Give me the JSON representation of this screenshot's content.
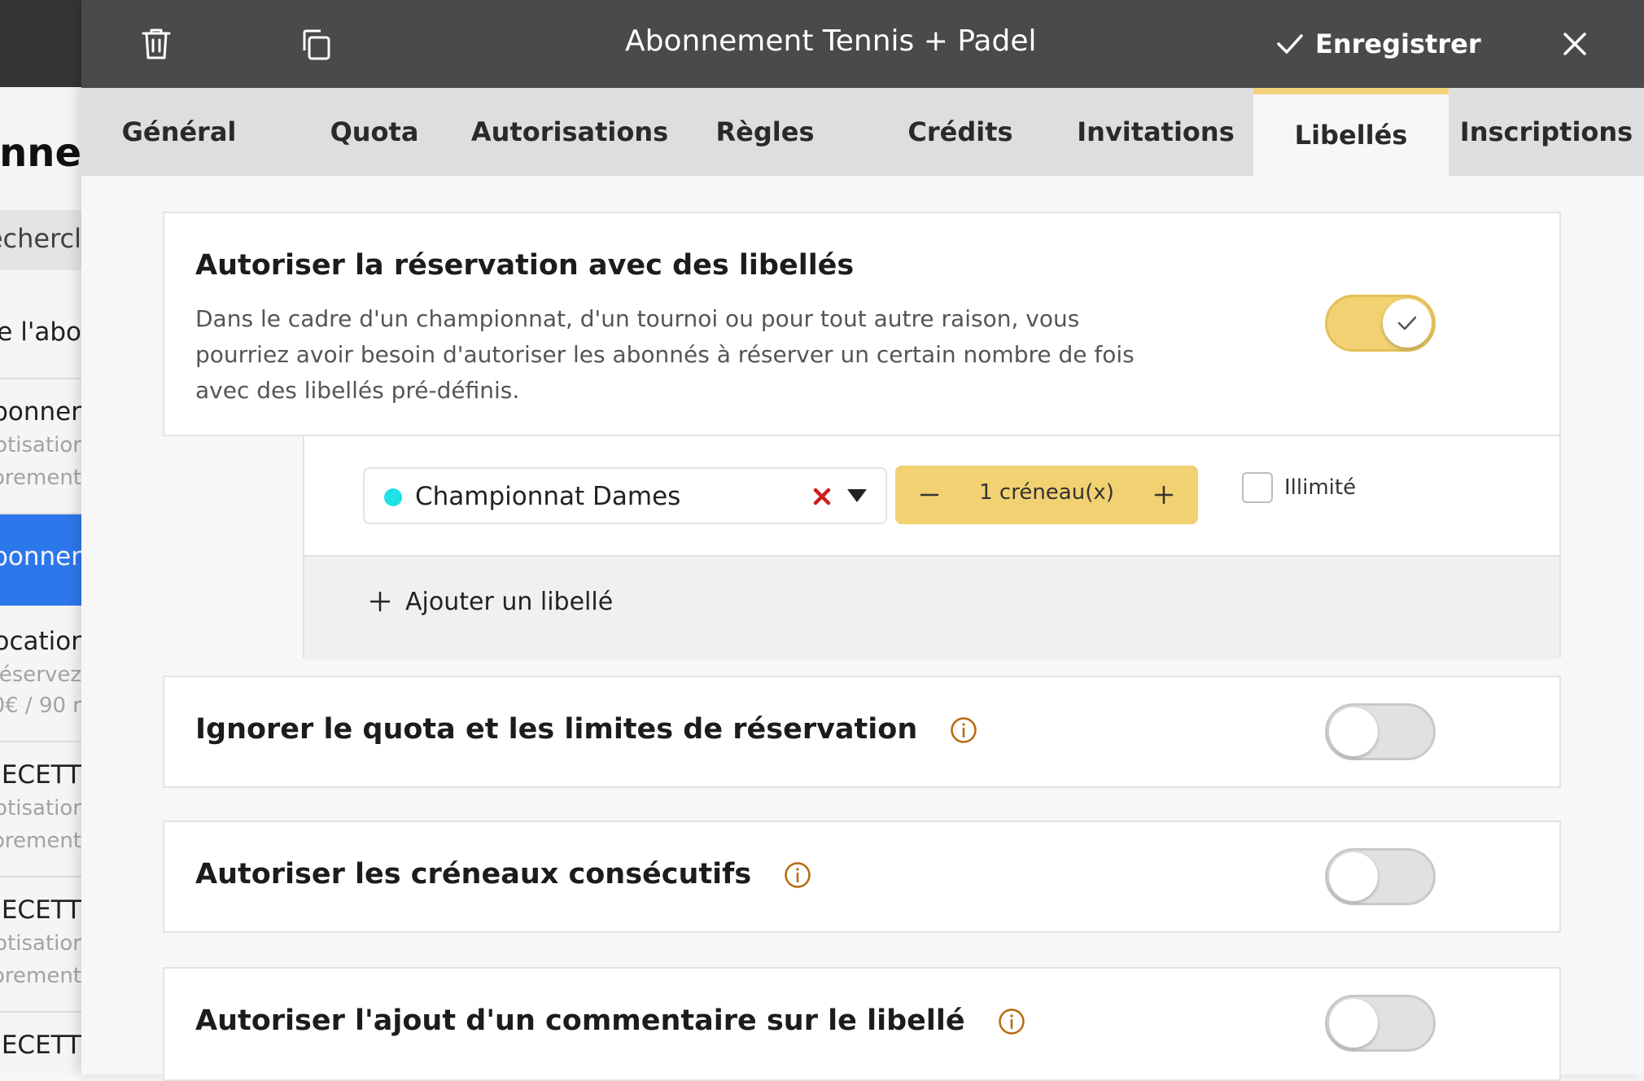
{
  "background": {
    "title": "onne",
    "search_placeholder": "echercl",
    "rows": [
      {
        "l1": "de l'abo",
        "l2": ""
      },
      {
        "l1": "bonner",
        "l2": "otisatior",
        "l3": "orement"
      },
      {
        "l1": "bonner",
        "l2": "",
        "l3": ""
      },
      {
        "l1": "ocatior",
        "l2": "éservez",
        "l3": "0€ / 90 r"
      },
      {
        "l1": "ECETT",
        "l2": "otisatior",
        "l3": "orement"
      },
      {
        "l1": "ECETT",
        "l2": "otisatior",
        "l3": "orement"
      },
      {
        "l1": "ECETT",
        "l2": "",
        "l3": ""
      }
    ]
  },
  "header": {
    "title": "Abonnement Tennis + Padel",
    "save_label": "Enregistrer",
    "icons": [
      "trash-icon",
      "duplicate-icon",
      "check-icon",
      "close-icon"
    ]
  },
  "tabs": [
    {
      "label": "Général"
    },
    {
      "label": "Quota"
    },
    {
      "label": "Autorisations"
    },
    {
      "label": "Règles"
    },
    {
      "label": "Crédits"
    },
    {
      "label": "Invitations"
    },
    {
      "label": "Libellés",
      "active": true
    },
    {
      "label": "Inscriptions"
    }
  ],
  "labels_section": {
    "title": "Autoriser la réservation avec des libellés",
    "description": "Dans le cadre d'un championnat, d'un tournoi ou pour tout autre raison, vous pourriez avoir besoin d'autoriser les abonnés à réserver un certain nombre de fois avec des libellés pré-définis.",
    "enabled": true,
    "entry": {
      "label": "Championnat Dames",
      "label_color": "#1fe1e6",
      "quantity_text": "1 créneau(x)",
      "quantity": 1,
      "unlimited_label": "Illimité",
      "unlimited": false
    },
    "add_label": "Ajouter un libellé"
  },
  "options": [
    {
      "title": "Ignorer le quota et les limites de réservation",
      "enabled": false
    },
    {
      "title": "Autoriser les créneaux consécutifs",
      "enabled": false
    },
    {
      "title": "Autoriser l'ajout d'un commentaire sur le libellé",
      "enabled": false
    }
  ],
  "colors": {
    "topbar": "#4a4a4a",
    "accent": "#f1d171",
    "info_icon": "#b8690f",
    "clear_x": "#cc1f1f",
    "active_row": "#2f7cf6"
  }
}
